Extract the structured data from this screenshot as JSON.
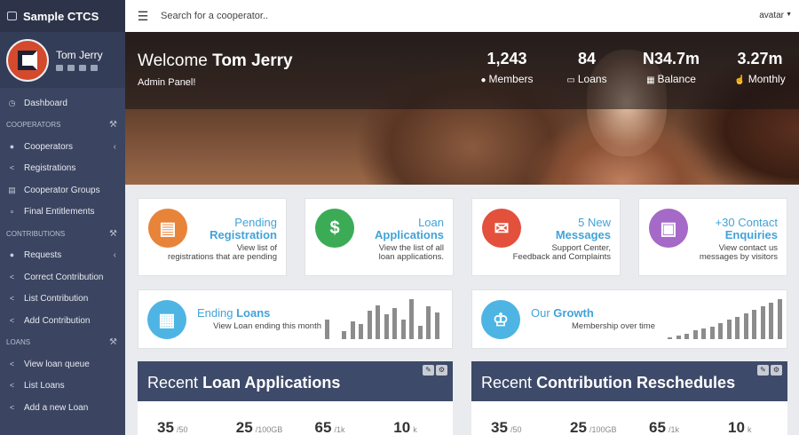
{
  "sidebar": {
    "brand": "Sample CTCS",
    "user_name": "Tom Jerry",
    "items": [
      {
        "type": "item",
        "label": "Dashboard",
        "icon": "clock-icon"
      },
      {
        "type": "section",
        "label": "COOPERATORS"
      },
      {
        "type": "item",
        "label": "Cooperators",
        "icon": "user-icon",
        "chevron": true
      },
      {
        "type": "item",
        "label": "Registrations",
        "icon": "share-icon"
      },
      {
        "type": "item",
        "label": "Cooperator Groups",
        "icon": "table-icon"
      },
      {
        "type": "item",
        "label": "Final Entitlements",
        "icon": "link-icon"
      },
      {
        "type": "section",
        "label": "CONTRIBUTIONS"
      },
      {
        "type": "item",
        "label": "Requests",
        "icon": "user-icon",
        "chevron": true
      },
      {
        "type": "item",
        "label": "Correct Contribution",
        "icon": "share-icon"
      },
      {
        "type": "item",
        "label": "List Contribution",
        "icon": "share-icon"
      },
      {
        "type": "item",
        "label": "Add Contribution",
        "icon": "share-icon"
      },
      {
        "type": "section",
        "label": "LOANS"
      },
      {
        "type": "item",
        "label": "View loan queue",
        "icon": "share-icon"
      },
      {
        "type": "item",
        "label": "List Loans",
        "icon": "share-icon"
      },
      {
        "type": "item",
        "label": "Add a new Loan",
        "icon": "share-icon"
      }
    ]
  },
  "topbar": {
    "search_placeholder": "Search for a cooperator..",
    "avatar_label": "avatar"
  },
  "banner": {
    "welcome": "Welcome",
    "name": "Tom Jerry",
    "subtitle": "Admin Panel!",
    "stats": [
      {
        "value": "1,243",
        "label": "Members",
        "icon": "user-icon"
      },
      {
        "value": "84",
        "label": "Loans",
        "icon": "money-icon"
      },
      {
        "value": "N34.7m",
        "label": "Balance",
        "icon": "calculator-icon"
      },
      {
        "value": "3.27m",
        "label": "Monthly",
        "icon": "thumbs-up-icon"
      }
    ]
  },
  "cards": [
    {
      "line1": "Pending",
      "line2": "Registration",
      "desc1": "View list of",
      "desc2": "registrations that are pending",
      "color": "#e8843a",
      "icon": "document-icon"
    },
    {
      "line1": "Loan",
      "line2": "Applications",
      "desc1": "View the list of all",
      "desc2": "loan applications.",
      "color": "#3cab56",
      "icon": "dollar-icon"
    },
    {
      "line1": "5 New",
      "line2": "Messages",
      "desc1": "Support Center,",
      "desc2": "Feedback and Complaints",
      "color": "#e3503c",
      "icon": "envelope-icon"
    },
    {
      "line1": "+30 Contact",
      "line2": "Enquiries",
      "desc1": "View contact us",
      "desc2": "messages by visitors",
      "color": "#a569c8",
      "icon": "image-icon"
    }
  ],
  "wide_cards": [
    {
      "title_light": "Ending",
      "title_bold": "Loans",
      "desc": "View Loan ending this month",
      "color": "#4eb4e3",
      "icon": "wallet-icon",
      "bars": [
        22,
        0,
        9,
        20,
        17,
        32,
        38,
        28,
        35,
        22,
        45,
        15,
        37,
        30
      ]
    },
    {
      "title_light": "Our",
      "title_bold": "Growth",
      "desc": "Membership over time",
      "color": "#4eb4e3",
      "icon": "crown-icon",
      "bars": [
        2,
        4,
        6,
        10,
        12,
        14,
        18,
        22,
        26,
        30,
        34,
        38,
        42,
        46
      ]
    }
  ],
  "panels": [
    {
      "title_light": "Recent",
      "title_bold": "Loan Applications",
      "kpis": [
        {
          "value": "35",
          "unit": "/50"
        },
        {
          "value": "25",
          "unit": "/100GB"
        },
        {
          "value": "65",
          "unit": "/1k"
        },
        {
          "value": "10",
          "unit": "k"
        }
      ]
    },
    {
      "title_light": "Recent",
      "title_bold": "Contribution Reschedules",
      "kpis": [
        {
          "value": "35",
          "unit": "/50"
        },
        {
          "value": "25",
          "unit": "/100GB"
        },
        {
          "value": "65",
          "unit": "/1k"
        },
        {
          "value": "10",
          "unit": "k"
        }
      ]
    }
  ]
}
